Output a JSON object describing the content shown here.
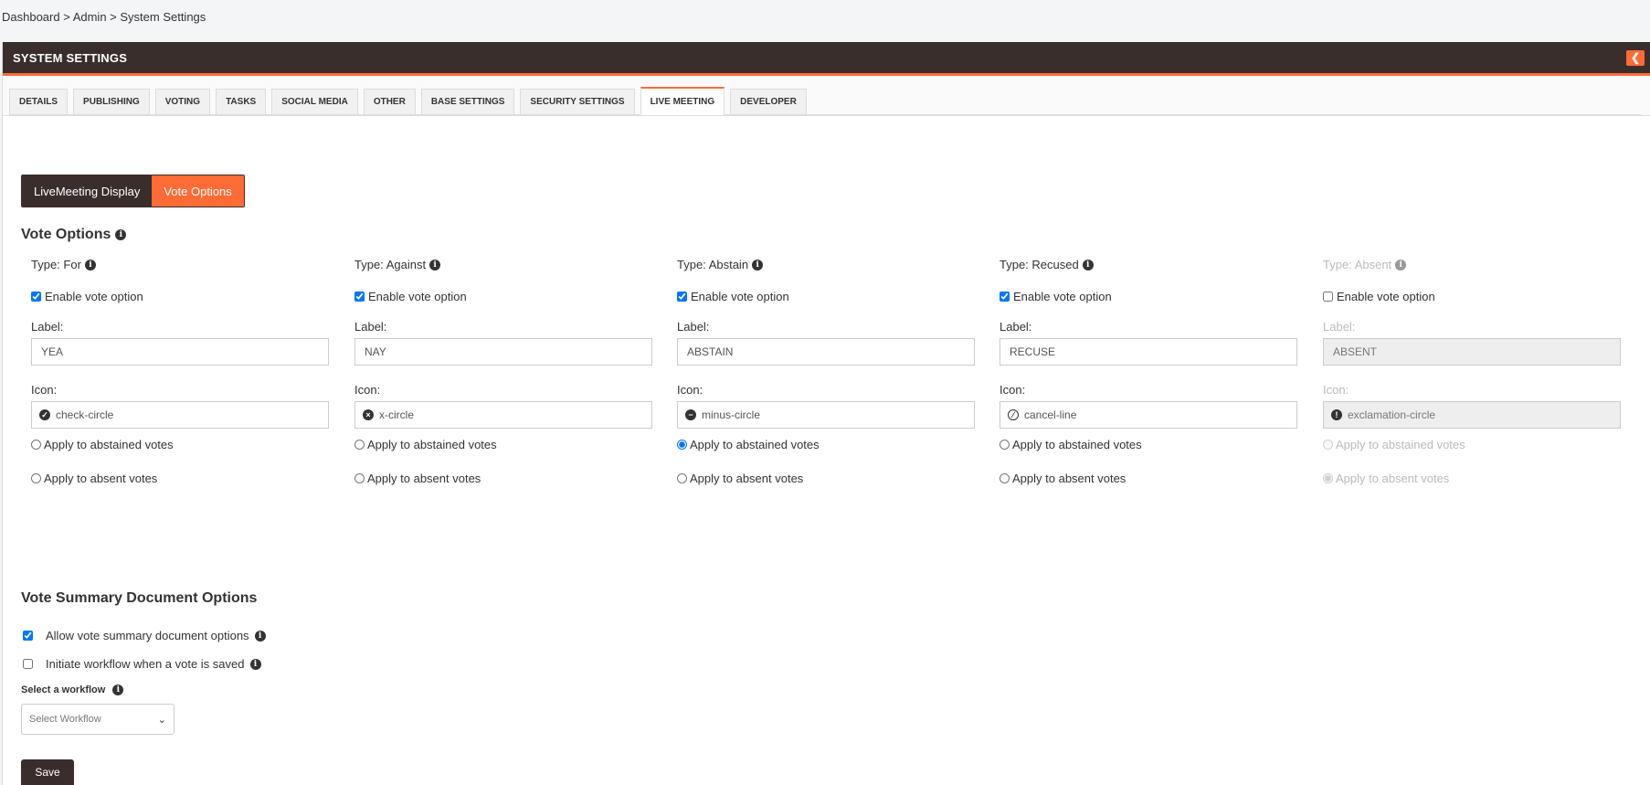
{
  "breadcrumb": "Dashboard > Admin > System Settings",
  "panel": {
    "title": "SYSTEM SETTINGS",
    "collapse_icon": "chevron-left-icon"
  },
  "tabs": [
    {
      "label": "DETAILS"
    },
    {
      "label": "PUBLISHING"
    },
    {
      "label": "VOTING"
    },
    {
      "label": "TASKS"
    },
    {
      "label": "SOCIAL MEDIA"
    },
    {
      "label": "OTHER"
    },
    {
      "label": "BASE SETTINGS"
    },
    {
      "label": "SECURITY SETTINGS"
    },
    {
      "label": "LIVE MEETING"
    },
    {
      "label": "DEVELOPER"
    }
  ],
  "active_tab": "LIVE MEETING",
  "toggle": {
    "display": "LiveMeeting Display",
    "vote_options": "Vote Options"
  },
  "vote_options": {
    "heading": "Vote Options",
    "enable_label": "Enable vote option",
    "label_caption": "Label:",
    "icon_caption": "Icon:",
    "apply_abstained": "Apply to abstained votes",
    "apply_absent": "Apply to absent votes",
    "types": [
      {
        "type": "Type: For",
        "enabled": true,
        "label": "YEA",
        "icon": "check-circle",
        "apply": "none"
      },
      {
        "type": "Type: Against",
        "enabled": true,
        "label": "NAY",
        "icon": "x-circle",
        "apply": "none"
      },
      {
        "type": "Type: Abstain",
        "enabled": true,
        "label": "ABSTAIN",
        "icon": "minus-circle",
        "apply": "abstained"
      },
      {
        "type": "Type: Recused",
        "enabled": true,
        "label": "RECUSE",
        "icon": "cancel-line",
        "apply": "none"
      },
      {
        "type": "Type: Absent",
        "enabled": false,
        "label": "ABSENT",
        "icon": "exclamation-circle",
        "apply": "absent"
      }
    ]
  },
  "summary": {
    "heading": "Vote Summary Document Options",
    "allow_label": "Allow vote summary document options",
    "allow_checked": true,
    "initiate_label": "Initiate workflow when a vote is saved",
    "initiate_checked": false,
    "workflow_label": "Select a workflow",
    "workflow_value": "Select Workflow"
  },
  "save_label": "Save",
  "colors": {
    "brand_dark": "#3a2e2c",
    "accent": "#ff6b35"
  }
}
